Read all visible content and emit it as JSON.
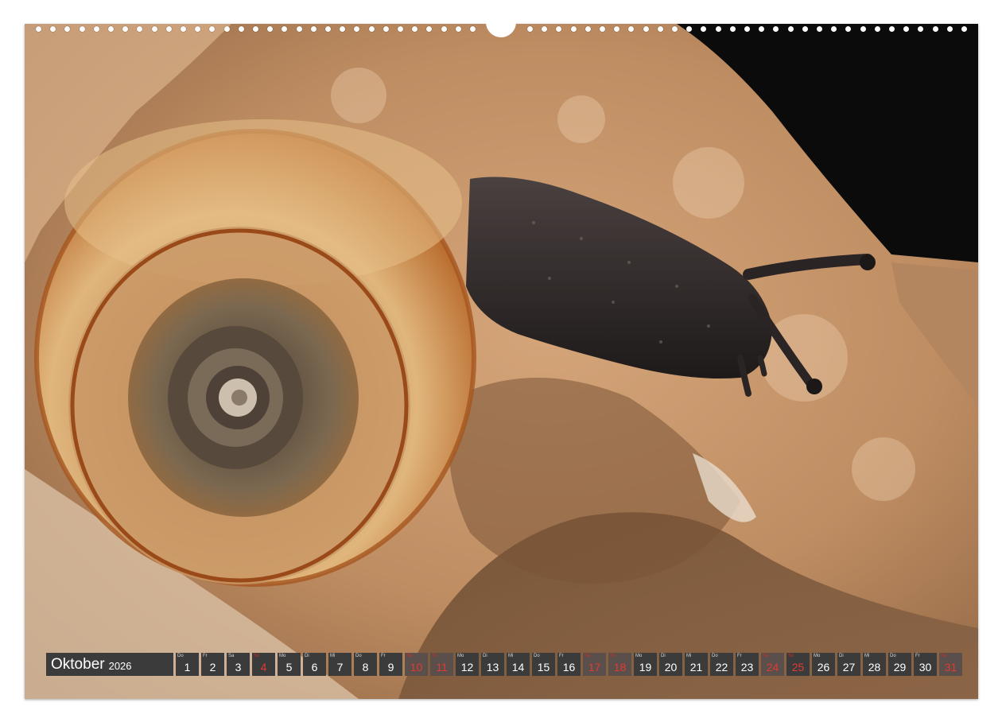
{
  "calendar": {
    "month": "Oktober",
    "year": "2026",
    "days": [
      {
        "wd": "Do",
        "n": "1",
        "type": "work"
      },
      {
        "wd": "Fr",
        "n": "2",
        "type": "work"
      },
      {
        "wd": "Sa",
        "n": "3",
        "type": "work"
      },
      {
        "wd": "So",
        "n": "4",
        "type": "sunday"
      },
      {
        "wd": "Mo",
        "n": "5",
        "type": "work"
      },
      {
        "wd": "Di",
        "n": "6",
        "type": "work"
      },
      {
        "wd": "Mi",
        "n": "7",
        "type": "work"
      },
      {
        "wd": "Do",
        "n": "8",
        "type": "work"
      },
      {
        "wd": "Fr",
        "n": "9",
        "type": "work"
      },
      {
        "wd": "Sa",
        "n": "10",
        "type": "weekend"
      },
      {
        "wd": "So",
        "n": "11",
        "type": "weekend"
      },
      {
        "wd": "Mo",
        "n": "12",
        "type": "work"
      },
      {
        "wd": "Di",
        "n": "13",
        "type": "work"
      },
      {
        "wd": "Mi",
        "n": "14",
        "type": "work"
      },
      {
        "wd": "Do",
        "n": "15",
        "type": "work"
      },
      {
        "wd": "Fr",
        "n": "16",
        "type": "work"
      },
      {
        "wd": "Sa",
        "n": "17",
        "type": "weekend"
      },
      {
        "wd": "So",
        "n": "18",
        "type": "weekend"
      },
      {
        "wd": "Mo",
        "n": "19",
        "type": "work"
      },
      {
        "wd": "Di",
        "n": "20",
        "type": "work"
      },
      {
        "wd": "Mi",
        "n": "21",
        "type": "work"
      },
      {
        "wd": "Do",
        "n": "22",
        "type": "work"
      },
      {
        "wd": "Fr",
        "n": "23",
        "type": "work"
      },
      {
        "wd": "Sa",
        "n": "24",
        "type": "weekend"
      },
      {
        "wd": "So",
        "n": "25",
        "type": "sunday"
      },
      {
        "wd": "Mo",
        "n": "26",
        "type": "work"
      },
      {
        "wd": "Di",
        "n": "27",
        "type": "work"
      },
      {
        "wd": "Mi",
        "n": "28",
        "type": "work"
      },
      {
        "wd": "Do",
        "n": "29",
        "type": "work"
      },
      {
        "wd": "Fr",
        "n": "30",
        "type": "work"
      },
      {
        "wd": "Sa",
        "n": "31",
        "type": "weekend"
      }
    ]
  },
  "colors": {
    "cell_bg": "#3b3b3b",
    "weekend_bg": "#5a4f4a",
    "holiday_red": "#e23a33"
  },
  "photo": {
    "subject_icons": [
      "snail-shell",
      "snail-body",
      "rock"
    ]
  }
}
